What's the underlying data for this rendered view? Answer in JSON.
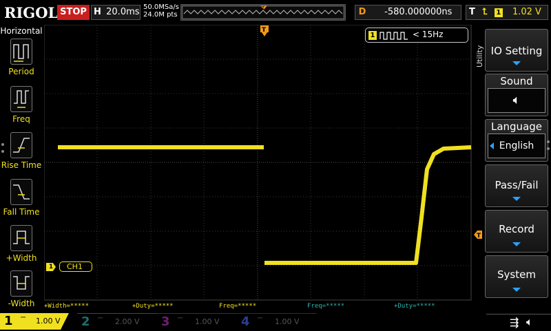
{
  "colors": {
    "ch1": "#f0e020",
    "ch2": "#2bb6b0",
    "ch3": "#d030d0",
    "ch4": "#3070ff",
    "trigger": "#f39a1a",
    "accent": "#2aa2ff",
    "stop": "#c91f1f"
  },
  "topbar": {
    "logo": "RIGOL",
    "run_state": "STOP",
    "horizontal_letter": "H",
    "timebase": "20.0ms",
    "sample_rate": "50.0MSa/s",
    "memory_depth": "24.0M pts",
    "trigger_delay_letter": "D",
    "trigger_delay": "-580.000000ns",
    "trigger_type_letter": "T",
    "trigger_source": "1",
    "trigger_level": "1.02 V"
  },
  "left_menu": {
    "title": "Horizontal",
    "items": [
      {
        "label": "Period",
        "icon": "period-icon"
      },
      {
        "label": "Freq",
        "icon": "frequency-icon"
      },
      {
        "label": "Rise Time",
        "icon": "rise-time-icon"
      },
      {
        "label": "Fall Time",
        "icon": "fall-time-icon"
      },
      {
        "label": "+Width",
        "icon": "positive-width-icon"
      },
      {
        "label": "-Width",
        "icon": "negative-width-icon"
      }
    ]
  },
  "scope": {
    "freq_badge_channel": "1",
    "freq_badge_text": "< 15Hz",
    "channel_label": "CH1",
    "channel_marker": "1"
  },
  "right_menu": {
    "title": "Utility",
    "items": [
      {
        "label": "IO Setting",
        "arrow": true
      },
      {
        "label": "Sound",
        "value_icon": "speaker-icon"
      },
      {
        "label": "Language",
        "value": "English"
      },
      {
        "label": "Pass/Fail",
        "arrow": true
      },
      {
        "label": "Record",
        "arrow": true
      },
      {
        "label": "System",
        "arrow": true
      }
    ]
  },
  "measurements": [
    {
      "text": "+Width=*****",
      "color": "#f0e020"
    },
    {
      "text": "+Duty=*****",
      "color": "#f0e020"
    },
    {
      "text": "Freq=*****",
      "color": "#f0e020"
    },
    {
      "text": "Freq=*****",
      "color": "#2bb6b0"
    },
    {
      "text": "+Duty=*****",
      "color": "#2bb6b0"
    }
  ],
  "channels": [
    {
      "num": "1",
      "scale": "1.00 V",
      "active": true
    },
    {
      "num": "2",
      "scale": "2.00 V",
      "active": false
    },
    {
      "num": "3",
      "scale": "1.00 V",
      "active": false
    },
    {
      "num": "4",
      "scale": "1.00 V",
      "active": false
    }
  ]
}
